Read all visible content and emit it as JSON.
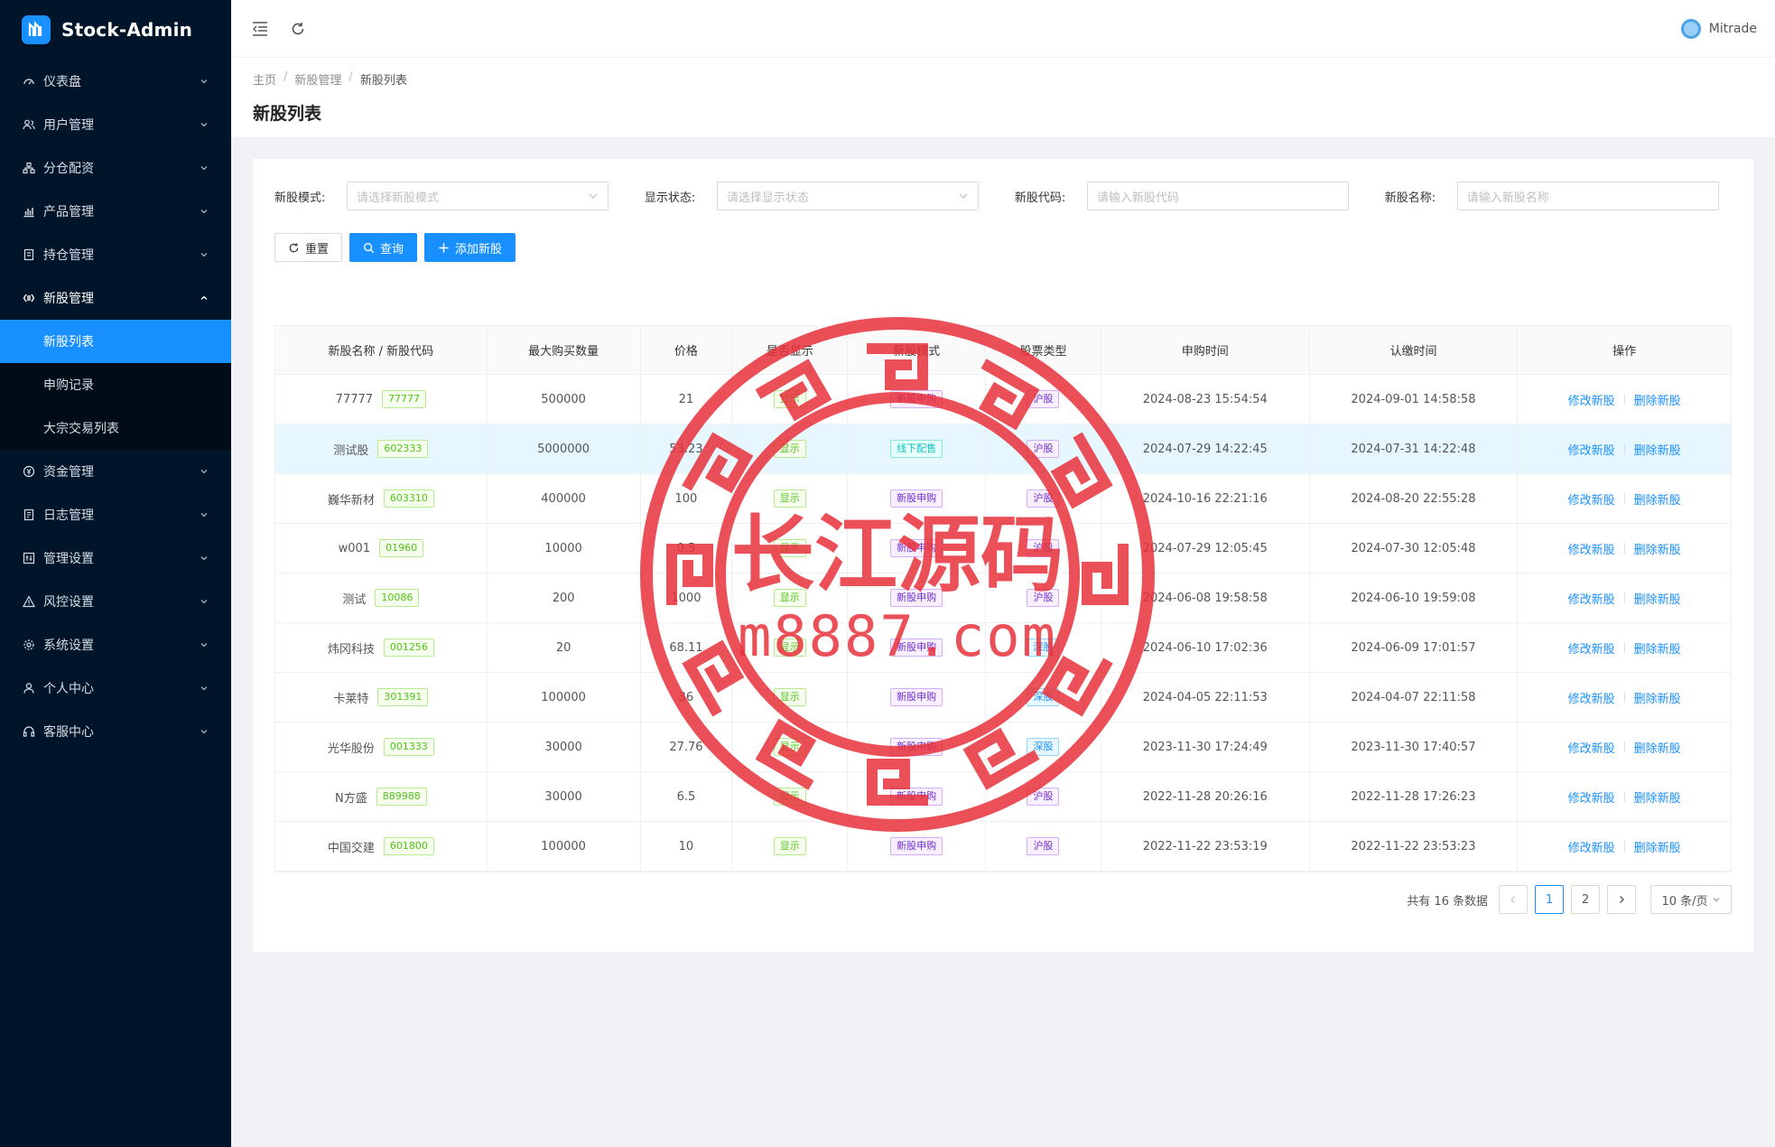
{
  "app": {
    "title": "Stock-Admin"
  },
  "sidebar": {
    "items": [
      {
        "label": "仪表盘",
        "icon": "dashboard-icon"
      },
      {
        "label": "用户管理",
        "icon": "users-icon"
      },
      {
        "label": "分仓配资",
        "icon": "cluster-icon"
      },
      {
        "label": "产品管理",
        "icon": "bar-chart-icon"
      },
      {
        "label": "持仓管理",
        "icon": "file-icon"
      },
      {
        "label": "新股管理",
        "icon": "code-icon",
        "open": true
      }
    ],
    "sub_items": [
      {
        "label": "新股列表",
        "active": true
      },
      {
        "label": "申购记录"
      },
      {
        "label": "大宗交易列表"
      }
    ],
    "items_after": [
      {
        "label": "资金管理",
        "icon": "money-icon"
      },
      {
        "label": "日志管理",
        "icon": "log-icon"
      },
      {
        "label": "管理设置",
        "icon": "settings-panel-icon"
      },
      {
        "label": "风控设置",
        "icon": "warning-icon"
      },
      {
        "label": "系统设置",
        "icon": "gear-icon"
      },
      {
        "label": "个人中心",
        "icon": "user-icon"
      },
      {
        "label": "客服中心",
        "icon": "headset-icon"
      }
    ]
  },
  "topbar": {
    "user_name": "Mitrade"
  },
  "breadcrumb": [
    "主页",
    "新股管理",
    "新股列表"
  ],
  "page_title": "新股列表",
  "filters": [
    {
      "label": "新股模式:",
      "placeholder": "请选择新股模式",
      "type": "select"
    },
    {
      "label": "显示状态:",
      "placeholder": "请选择显示状态",
      "type": "select"
    },
    {
      "label": "新股代码:",
      "placeholder": "请输入新股代码",
      "type": "input"
    },
    {
      "label": "新股名称:",
      "placeholder": "请输入新股名称",
      "type": "input"
    }
  ],
  "buttons": {
    "reset": "重置",
    "query": "查询",
    "add": "添加新股"
  },
  "table": {
    "columns": [
      "新股名称 / 新股代码",
      "最大购买数量",
      "价格",
      "是否显示",
      "新股模式",
      "股票类型",
      "申购时间",
      "认缴时间",
      "操作"
    ],
    "rows": [
      {
        "name": "77777",
        "code": "77777",
        "max": "500000",
        "price": "21",
        "show": "显示",
        "mode": "新股申购",
        "type": "沪股",
        "sub_time": "2024-08-23 15:54:54",
        "pay_time": "2024-09-01 14:58:58"
      },
      {
        "name": "测试股",
        "code": "602333",
        "max": "5000000",
        "price": "53.23",
        "show": "显示",
        "mode": "线下配售",
        "type": "沪股",
        "sub_time": "2024-07-29 14:22:45",
        "pay_time": "2024-07-31 14:22:48"
      },
      {
        "name": "巍华新材",
        "code": "603310",
        "max": "400000",
        "price": "100",
        "show": "显示",
        "mode": "新股申购",
        "type": "沪股",
        "sub_time": "2024-10-16 22:21:16",
        "pay_time": "2024-08-20 22:55:28"
      },
      {
        "name": "w001",
        "code": "01960",
        "max": "10000",
        "price": "0.5",
        "show": "显示",
        "mode": "新股申购",
        "type": "沪股",
        "sub_time": "2024-07-29 12:05:45",
        "pay_time": "2024-07-30 12:05:48"
      },
      {
        "name": "测试",
        "code": "10086",
        "max": "200",
        "price": "1000",
        "show": "显示",
        "mode": "新股申购",
        "type": "沪股",
        "sub_time": "2024-06-08 19:58:58",
        "pay_time": "2024-06-10 19:59:08"
      },
      {
        "name": "炜冈科技",
        "code": "001256",
        "max": "20",
        "price": "68.11",
        "show": "显示",
        "mode": "新股申购",
        "type": "深股",
        "sub_time": "2024-06-10 17:02:36",
        "pay_time": "2024-06-09 17:01:57"
      },
      {
        "name": "卡莱特",
        "code": "301391",
        "max": "100000",
        "price": "36",
        "show": "显示",
        "mode": "新股申购",
        "type": "深股",
        "sub_time": "2024-04-05 22:11:53",
        "pay_time": "2024-04-07 22:11:58"
      },
      {
        "name": "光华股份",
        "code": "001333",
        "max": "30000",
        "price": "27.76",
        "show": "显示",
        "mode": "新股申购",
        "type": "深股",
        "sub_time": "2023-11-30 17:24:49",
        "pay_time": "2023-11-30 17:40:57"
      },
      {
        "name": "N方盛",
        "code": "889988",
        "max": "30000",
        "price": "6.5",
        "show": "显示",
        "mode": "新股申购",
        "type": "沪股",
        "sub_time": "2022-11-28 20:26:16",
        "pay_time": "2022-11-28 17:26:23"
      },
      {
        "name": "中国交建",
        "code": "601800",
        "max": "100000",
        "price": "10",
        "show": "显示",
        "mode": "新股申购",
        "type": "沪股",
        "sub_time": "2022-11-22 23:53:19",
        "pay_time": "2022-11-22 23:53:23"
      }
    ],
    "actions": {
      "edit": "修改新股",
      "delete": "删除新股"
    }
  },
  "pagination": {
    "total_text": "共有 16 条数据",
    "pages": [
      "1",
      "2"
    ],
    "current": "1",
    "page_size": "10 条/页"
  },
  "watermark": {
    "text_cn": "长江源码",
    "text_url": "m8887.com",
    "color": "#e8313a"
  },
  "colors": {
    "primary": "#1890ff",
    "sidebar_bg": "#001529"
  }
}
